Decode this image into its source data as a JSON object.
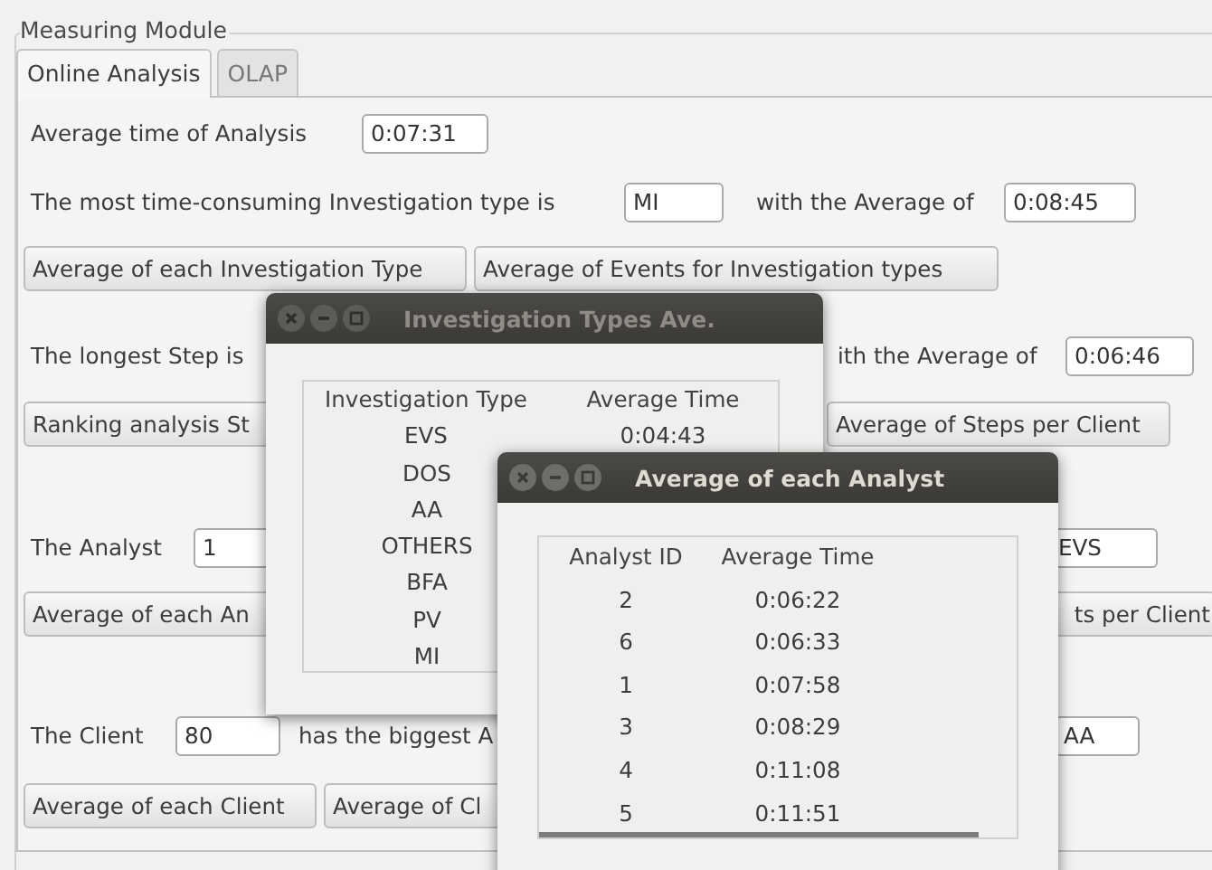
{
  "group_title": "Measuring Module",
  "tabs": [
    {
      "label": "Online Analysis",
      "selected": true
    },
    {
      "label": "OLAP",
      "selected": false
    }
  ],
  "rows": [
    [
      {
        "kind": "label",
        "text": "Average time of Analysis"
      },
      {
        "kind": "field",
        "value": "0:07:31"
      }
    ],
    [
      {
        "kind": "label",
        "text": "The most time-consuming Investigation type is"
      },
      {
        "kind": "field",
        "value": "MI"
      },
      {
        "kind": "label",
        "text": "with the Average of"
      },
      {
        "kind": "field",
        "value": "0:08:45"
      }
    ],
    [
      {
        "kind": "button",
        "text": "Average of each Investigation Type"
      },
      {
        "kind": "button",
        "text": "Average of Events for Investigation types"
      }
    ],
    [
      {
        "kind": "label",
        "text": "The longest Step is"
      },
      {
        "kind": "label",
        "text": "ith the Average of"
      },
      {
        "kind": "field",
        "value": "0:06:46"
      }
    ],
    [
      {
        "kind": "button",
        "text": "Ranking analysis St"
      },
      {
        "kind": "button",
        "text": "Average of Steps per Client"
      }
    ],
    [
      {
        "kind": "label",
        "text": "The Analyst"
      },
      {
        "kind": "field",
        "value": "1"
      },
      {
        "kind": "field",
        "value": "EVS"
      }
    ],
    [
      {
        "kind": "button",
        "text": "Average of each An"
      },
      {
        "kind": "button",
        "text": "ts per Client"
      }
    ],
    [
      {
        "kind": "label",
        "text": "The Client"
      },
      {
        "kind": "field",
        "value": "80"
      },
      {
        "kind": "label",
        "text": "has the biggest A"
      },
      {
        "kind": "field",
        "value": "AA"
      }
    ],
    [
      {
        "kind": "button",
        "text": "Average of each Client"
      },
      {
        "kind": "button",
        "text": "Average of Cl"
      }
    ]
  ],
  "dialogs": [
    {
      "title": "Investigation Types Ave.",
      "active": false,
      "columns": [
        "Investigation Type",
        "Average Time"
      ],
      "rows": [
        [
          "EVS",
          "0:04:43"
        ],
        [
          "DOS"
        ],
        [
          "AA"
        ],
        [
          "OTHERS"
        ],
        [
          "BFA"
        ],
        [
          "PV"
        ],
        [
          "MI"
        ]
      ]
    },
    {
      "title": "Average of each Analyst",
      "active": true,
      "columns": [
        "Analyst ID",
        "Average Time"
      ],
      "rows": [
        [
          "2",
          "0:06:22"
        ],
        [
          "6",
          "0:06:33"
        ],
        [
          "1",
          "0:07:58"
        ],
        [
          "3",
          "0:08:29"
        ],
        [
          "4",
          "0:11:08"
        ],
        [
          "5",
          "0:11:51"
        ]
      ]
    }
  ]
}
